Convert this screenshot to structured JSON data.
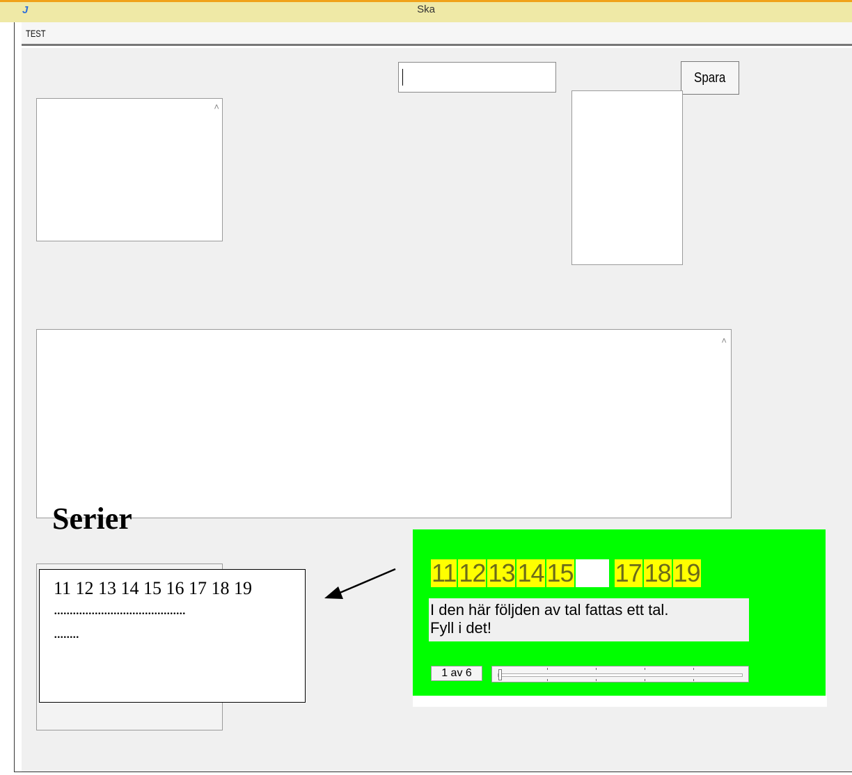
{
  "window": {
    "title": "Ska",
    "app_icon": "J"
  },
  "menubar": {
    "items": [
      "TEST"
    ]
  },
  "form": {
    "save_button": "Spara",
    "name_input_value": ""
  },
  "annotation": {
    "heading": "Serier",
    "sequence_line": "11 12 13 14 15 16 17 18 19",
    "dots_line1": "..........................................",
    "dots_line2": "........"
  },
  "preview": {
    "numbers": [
      "11",
      "12",
      "13",
      "14",
      "15",
      "",
      "17",
      "18",
      "19"
    ],
    "instruction_line1": "I den här följden av tal fattas ett tal.",
    "instruction_line2": "Fyll i det!",
    "counter": "1 av 6",
    "current_item": 1,
    "total_items": 6
  },
  "colors": {
    "preview_background": "#00ff00",
    "number_cell": "#ffff00",
    "title_bar": "#efe9a6"
  }
}
